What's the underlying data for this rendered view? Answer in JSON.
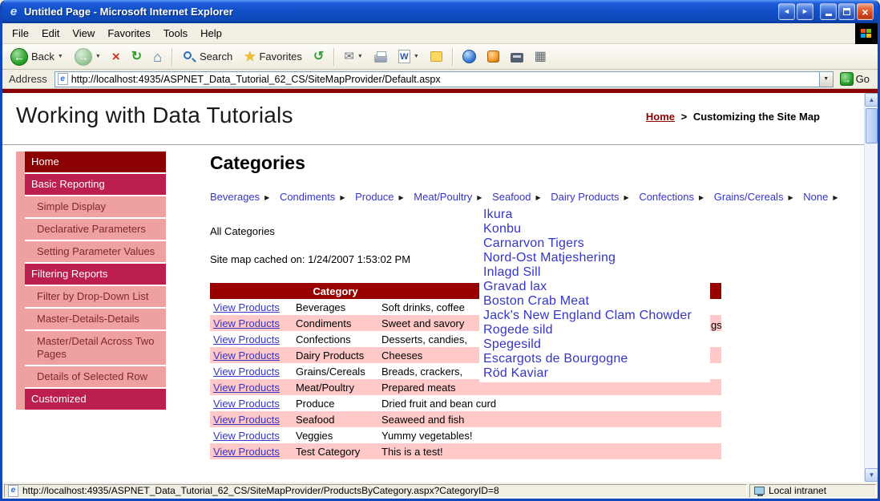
{
  "window": {
    "title": "Untitled Page - Microsoft Internet Explorer"
  },
  "menu": {
    "items": [
      "File",
      "Edit",
      "View",
      "Favorites",
      "Tools",
      "Help"
    ]
  },
  "toolbar": {
    "back": "Back",
    "search": "Search",
    "favorites": "Favorites"
  },
  "address": {
    "label": "Address",
    "url": "http://localhost:4935/ASPNET_Data_Tutorial_62_CS/SiteMapProvider/Default.aspx",
    "go": "Go"
  },
  "page": {
    "title": "Working with Data Tutorials",
    "breadcrumb": {
      "home": "Home",
      "sep": ">",
      "current": "Customizing the Site Map"
    },
    "sidebar": [
      {
        "label": "Home",
        "type": "dark"
      },
      {
        "label": "Basic Reporting",
        "type": "mid"
      },
      {
        "label": "Simple Display",
        "type": "sub"
      },
      {
        "label": "Declarative Parameters",
        "type": "sub"
      },
      {
        "label": "Setting Parameter Values",
        "type": "sub"
      },
      {
        "label": "Filtering Reports",
        "type": "mid"
      },
      {
        "label": "Filter by Drop-Down List",
        "type": "sub"
      },
      {
        "label": "Master-Details-Details",
        "type": "sub"
      },
      {
        "label": "Master/Detail Across Two Pages",
        "type": "sub"
      },
      {
        "label": "Details of Selected Row",
        "type": "sub"
      },
      {
        "label": "Customized",
        "type": "mid"
      }
    ],
    "main": {
      "heading": "Categories",
      "menu": [
        "Beverages",
        "Condiments",
        "Produce",
        "Meat/Poultry",
        "Seafood",
        "Dairy Products",
        "Confections",
        "Grains/Cereals",
        "None"
      ],
      "all_categories": "All Categories",
      "cache_note": "Site map cached on: 1/24/2007 1:53:02 PM",
      "table": {
        "category_header": "Category",
        "link_label": "View Products",
        "desc_tail": "gs",
        "rows": [
          {
            "category": "Beverages",
            "desc": "Soft drinks, coffee"
          },
          {
            "category": "Condiments",
            "desc": "Sweet and savory"
          },
          {
            "category": "Confections",
            "desc": "Desserts, candies,"
          },
          {
            "category": "Dairy Products",
            "desc": "Cheeses"
          },
          {
            "category": "Grains/Cereals",
            "desc": "Breads, crackers,"
          },
          {
            "category": "Meat/Poultry",
            "desc": "Prepared meats"
          },
          {
            "category": "Produce",
            "desc": "Dried fruit and bean curd"
          },
          {
            "category": "Seafood",
            "desc": "Seaweed and fish"
          },
          {
            "category": "Veggies",
            "desc": "Yummy vegetables!"
          },
          {
            "category": "Test Category",
            "desc": "This is a test!"
          }
        ]
      },
      "flyout": [
        "Ikura",
        "Konbu",
        "Carnarvon Tigers",
        "Nord-Ost Matjeshering",
        "Inlagd Sill",
        "Gravad lax",
        "Boston Crab Meat",
        "Jack's New England Clam Chowder",
        "Rogede sild",
        "Spegesild",
        "Escargots de Bourgogne",
        "Röd Kaviar"
      ]
    }
  },
  "status": {
    "url": "http://localhost:4935/ASPNET_Data_Tutorial_62_CS/SiteMapProvider/ProductsByCategory.aspx?CategoryID=8",
    "zone": "Local intranet"
  },
  "colors": {
    "maroon": "#8B0000",
    "crimson": "#BC1E4E",
    "pink": "#EFA0A0",
    "row_pink": "#FFC9C9",
    "header_red": "#990000",
    "link_blue": "#3535C8"
  },
  "icons": {
    "ie_e": "e",
    "close": "×",
    "titlebar_left": "◄",
    "titlebar_right": "►",
    "back_arrow": "←",
    "forward_arrow": "→",
    "stop": "×",
    "refresh": "↻",
    "home": "⌂",
    "star": "★",
    "history": "↺",
    "mail": "✉",
    "edit_w": "W",
    "dropdown": "▼",
    "go_arrow": "→",
    "menu_arrow": "▶",
    "scroll_up": "▲",
    "scroll_down": "▼",
    "tiles": "▦"
  }
}
